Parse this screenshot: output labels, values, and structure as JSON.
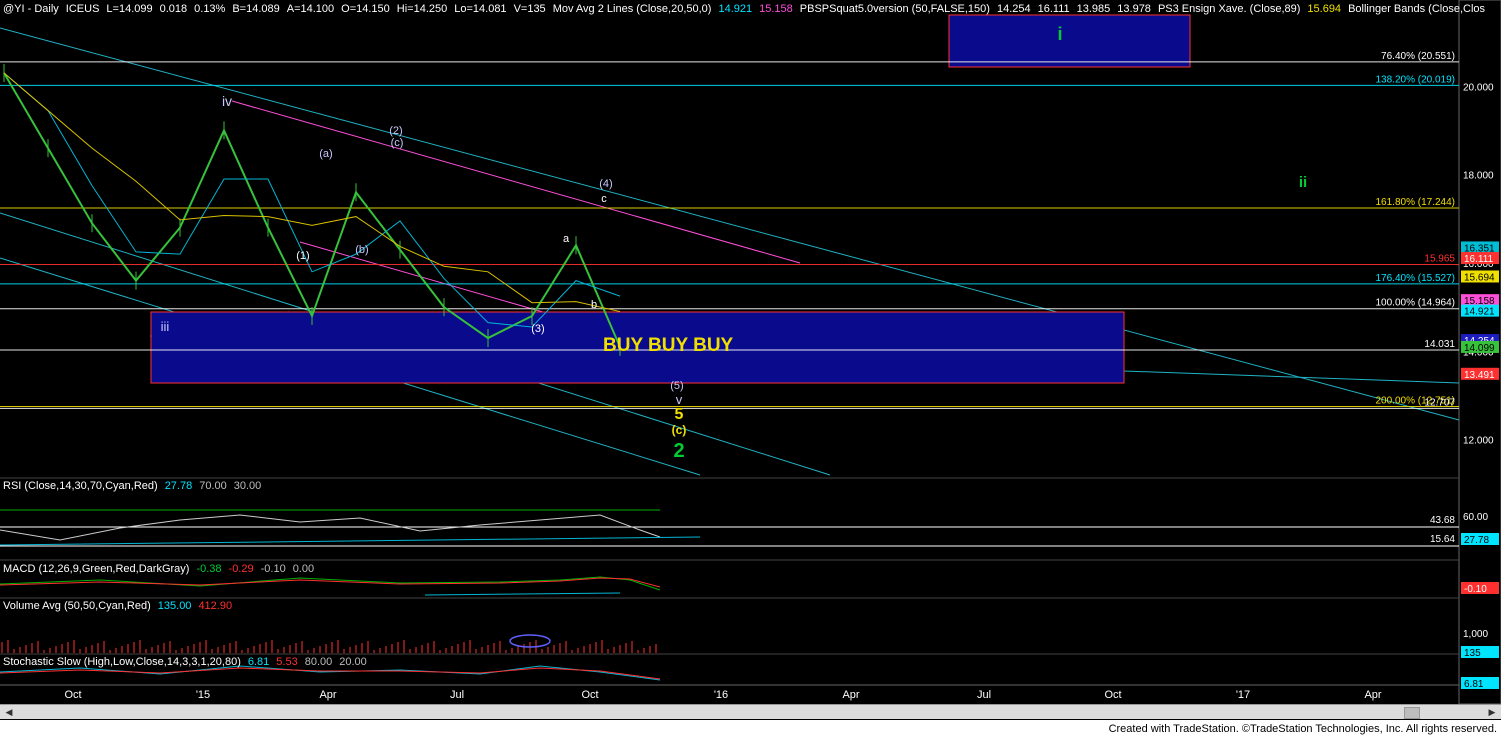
{
  "header": {
    "symbol": "@YI - Daily",
    "exchange": "ICEUS",
    "last": "L=14.099",
    "change": "0.018",
    "change_pct": "0.13%",
    "bid": "B=14.089",
    "ask": "A=14.100",
    "open": "O=14.150",
    "high": "Hi=14.250",
    "low": "Lo=14.081",
    "volume": "V=135",
    "study1_name": "Mov Avg 2 Lines (Close,20,50,0)",
    "study1_v1": "14.921",
    "study1_v2": "15.158",
    "study2_name": "PBSPSquat5.0version (50,FALSE,150)",
    "study2_v1": "14.254",
    "study2_v2": "16.111",
    "study2_v3": "13.985",
    "study2_v4": "13.978",
    "study3_name": "PS3 Ensign Xave. (Close,89)",
    "study3_v1": "15.694",
    "study4_name": "Bollinger Bands (Close,Clos"
  },
  "colors": {
    "cyan": "#00e5ff",
    "price_green": "#36c23a",
    "fib_white": "#ffffff",
    "fib_red": "#ff3030",
    "magenta": "#ff4fd8",
    "yellow_ma": "#d8c000",
    "box_blue": "#0a0a8c",
    "box_border": "#ff3030"
  },
  "price_axis": {
    "ticks": [
      "20.000",
      "18.000",
      "16.000",
      "14.000",
      "12.000"
    ],
    "ymin": 11.2,
    "ymax": 21.5,
    "tags": [
      {
        "label": "16.351",
        "value": 16.351,
        "bg": "#00bcd4",
        "fg": "#000"
      },
      {
        "label": "16.111",
        "value": 16.111,
        "bg": "#ff3030",
        "fg": "#fff"
      },
      {
        "label": "15.694",
        "value": 15.694,
        "bg": "#f0e000",
        "fg": "#000"
      },
      {
        "label": "15.158",
        "value": 15.158,
        "bg": "#ff4fd8",
        "fg": "#000"
      },
      {
        "label": "14.921",
        "value": 14.921,
        "bg": "#00e5ff",
        "fg": "#000"
      },
      {
        "label": "14.254",
        "value": 14.254,
        "bg": "#1c1cc0",
        "fg": "#fff"
      },
      {
        "label": "14.099",
        "value": 14.099,
        "bg": "#36c23a",
        "fg": "#000"
      },
      {
        "label": "13.491",
        "value": 13.491,
        "bg": "#ff3030",
        "fg": "#fff"
      }
    ]
  },
  "fib_levels": [
    {
      "label": "76.40% (20.551)",
      "value": 20.551,
      "color": "#ffffff"
    },
    {
      "label": "138.20% (20.019)",
      "value": 20.019,
      "color": "#00e5ff"
    },
    {
      "label": "161.80% (17.244)",
      "value": 17.244,
      "color": "#f0e000"
    },
    {
      "label": "15.965",
      "value": 15.965,
      "color": "#ff3030"
    },
    {
      "label": "176.40% (15.527)",
      "value": 15.527,
      "color": "#00e5ff"
    },
    {
      "label": "100.00% (14.964)",
      "value": 14.964,
      "color": "#ffffff"
    },
    {
      "label": "14.031",
      "value": 14.031,
      "color": "#ffffff"
    },
    {
      "label": "200.00% (12.751)",
      "value": 12.751,
      "color": "#f0e000"
    },
    {
      "label": "12.707",
      "value": 12.707,
      "color": "#ffffff"
    }
  ],
  "annotations": {
    "buy": "BUY BUY BUY",
    "wave_i": "i",
    "wave_ii": "ii",
    "wave_iii": "iii",
    "wave_iv": "iv",
    "w1": "(1)",
    "w2": "(2)",
    "w3": "(3)",
    "w4": "(4)",
    "w5": "(5)",
    "wa": "(a)",
    "wb": "(b)",
    "wc": "(c)",
    "a": "a",
    "b": "b",
    "c": "c",
    "v": "v",
    "five": "5",
    "c_y": "(c)",
    "two": "2"
  },
  "rsi": {
    "title": "RSI (Close,14,30,70,Cyan,Red)",
    "v": "27.78",
    "ob": "70.00",
    "os": "30.00",
    "tick": "60.00",
    "lvl1": "43.68",
    "lvl2": "15.64",
    "tag": "27.78"
  },
  "macd": {
    "title": "MACD (12,26,9,Green,Red,DarkGray)",
    "v1": "-0.38",
    "v2": "-0.29",
    "v3": "-0.10",
    "v4": "0.00",
    "tag": "-0.10"
  },
  "volume": {
    "title": "Volume Avg (50,50,Cyan,Red)",
    "v1": "135.00",
    "v2": "412.90",
    "tick": "1,000",
    "tag": "135"
  },
  "stoch": {
    "title": "Stochastic Slow (High,Low,Close,14,3,3,1,20,80)",
    "v1": "6.81",
    "v2": "5.53",
    "v3": "80.00",
    "v4": "20.00",
    "tag": "6.81"
  },
  "time_axis": [
    "Oct",
    "'15",
    "Apr",
    "Jul",
    "Oct",
    "'16",
    "Apr",
    "Jul",
    "Oct",
    "'17",
    "Apr"
  ],
  "chart_data": {
    "type": "line",
    "title": "@YI - Daily",
    "series": [
      {
        "name": "@YI - Daily",
        "x": [
          "2014-09",
          "2014-10",
          "2014-11",
          "2014-12",
          "2015-01",
          "2015-02",
          "2015-03",
          "2015-04",
          "2015-05",
          "2015-06",
          "2015-07",
          "2015-08",
          "2015-09",
          "2015-10",
          "2015-11"
        ],
        "values": [
          20.3,
          18.6,
          16.9,
          15.6,
          16.8,
          19.0,
          16.8,
          14.8,
          17.6,
          16.3,
          15.0,
          14.3,
          14.8,
          16.4,
          14.1
        ]
      }
    ],
    "x_range": [
      "2014-09",
      "2017-05"
    ],
    "ylim": [
      11.2,
      21.5
    ],
    "grid": false
  }
}
